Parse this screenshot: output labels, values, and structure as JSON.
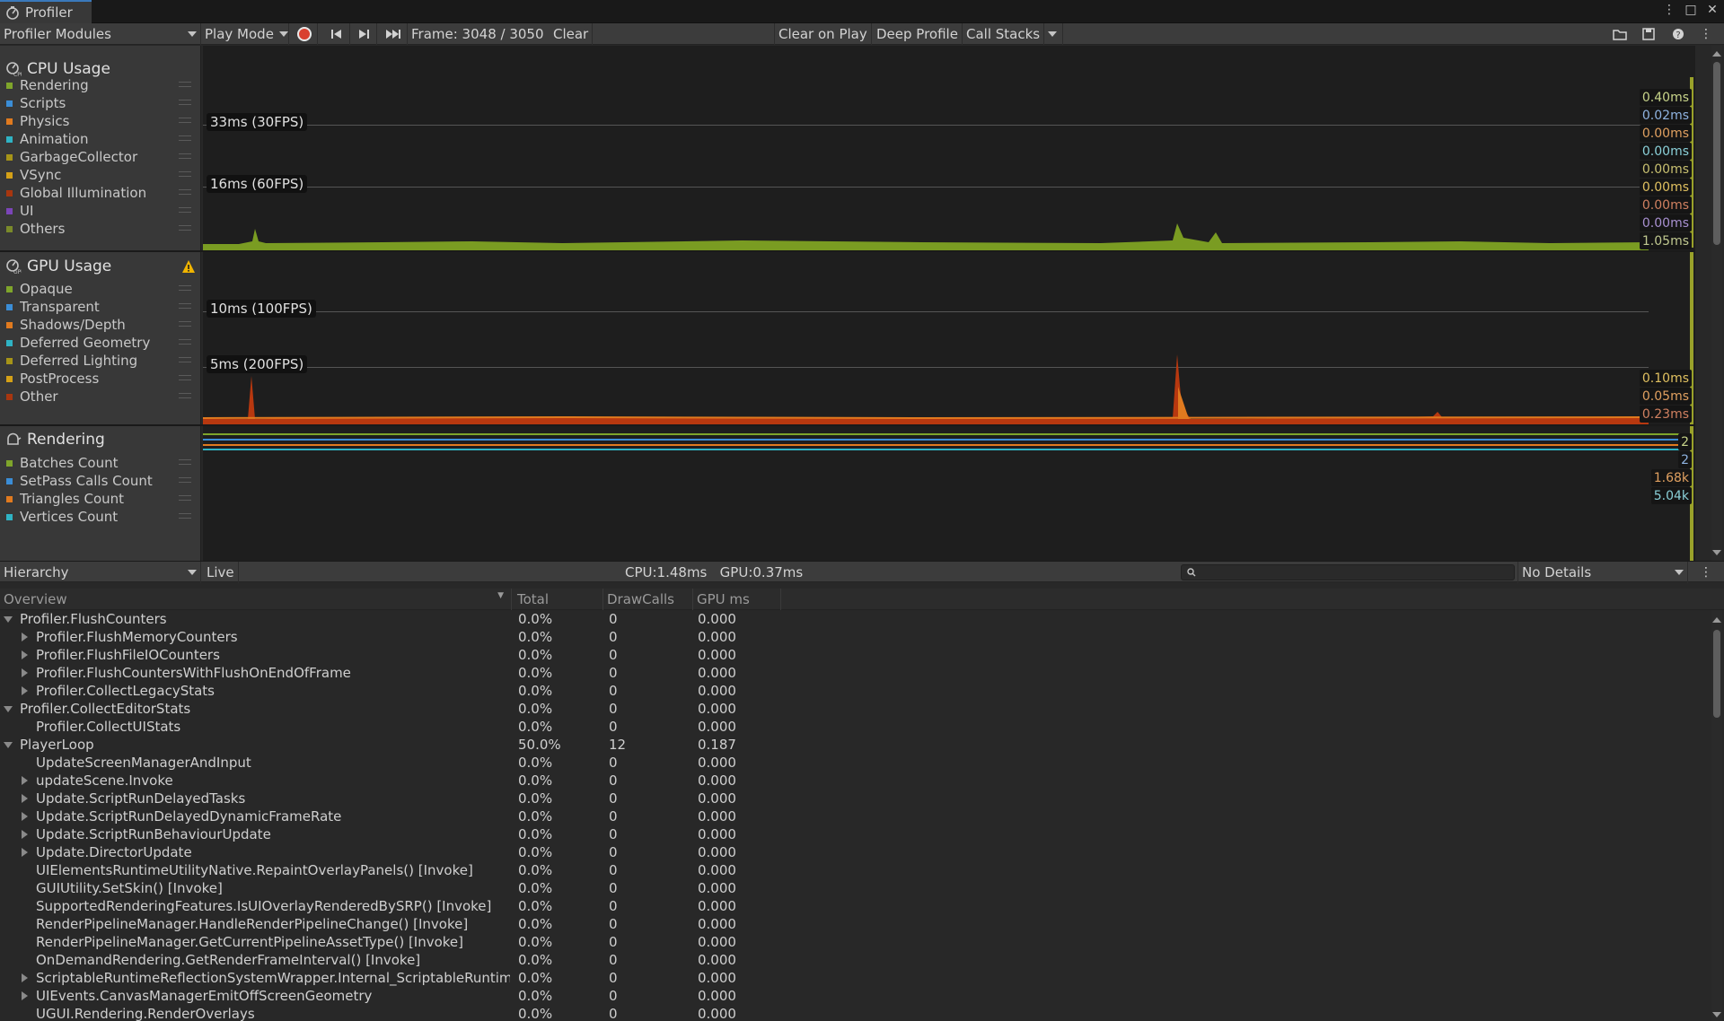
{
  "window": {
    "tab_title": "Profiler",
    "controls": [
      "⋮",
      "□",
      "✕"
    ]
  },
  "toolbar": {
    "modules_label": "Profiler Modules",
    "mode_label": "Play Mode",
    "frame_label": "Frame: 3048 / 3050",
    "clear_label": "Clear",
    "clear_on_play_label": "Clear on Play",
    "deep_profile_label": "Deep Profile",
    "call_stacks_label": "Call Stacks"
  },
  "cpu_module": {
    "title": "CPU Usage",
    "items": [
      {
        "label": "Rendering",
        "color": "#7fa52b"
      },
      {
        "label": "Scripts",
        "color": "#3b8dd6"
      },
      {
        "label": "Physics",
        "color": "#e07a1f"
      },
      {
        "label": "Animation",
        "color": "#2fb3c4"
      },
      {
        "label": "GarbageCollector",
        "color": "#a69418"
      },
      {
        "label": "VSync",
        "color": "#d4a017"
      },
      {
        "label": "Global Illumination",
        "color": "#a8360f"
      },
      {
        "label": "UI",
        "color": "#7b45b8"
      },
      {
        "label": "Others",
        "color": "#7a8a2a"
      }
    ],
    "fps_lines": [
      "33ms (30FPS)",
      "16ms (60FPS)"
    ],
    "values": [
      {
        "text": "0.40ms",
        "color": "#c8d48a"
      },
      {
        "text": "0.02ms",
        "color": "#8fb3e0"
      },
      {
        "text": "0.00ms",
        "color": "#e0a060"
      },
      {
        "text": "0.00ms",
        "color": "#8ad0d8"
      },
      {
        "text": "0.00ms",
        "color": "#c8c070"
      },
      {
        "text": "0.00ms",
        "color": "#e0c060"
      },
      {
        "text": "0.00ms",
        "color": "#d08060"
      },
      {
        "text": "0.00ms",
        "color": "#a890d0"
      },
      {
        "text": "1.05ms",
        "color": "#c0c890"
      }
    ]
  },
  "gpu_module": {
    "title": "GPU Usage",
    "items": [
      {
        "label": "Opaque",
        "color": "#7fa52b"
      },
      {
        "label": "Transparent",
        "color": "#3b8dd6"
      },
      {
        "label": "Shadows/Depth",
        "color": "#e07a1f"
      },
      {
        "label": "Deferred Geometry",
        "color": "#2fb3c4"
      },
      {
        "label": "Deferred Lighting",
        "color": "#a69418"
      },
      {
        "label": "PostProcess",
        "color": "#d4a017"
      },
      {
        "label": "Other",
        "color": "#a8360f"
      }
    ],
    "fps_lines": [
      "10ms (100FPS)",
      "5ms (200FPS)"
    ],
    "values": [
      {
        "text": "0.10ms",
        "color": "#e0c060"
      },
      {
        "text": "0.05ms",
        "color": "#e0a060"
      },
      {
        "text": "0.23ms",
        "color": "#d08060"
      }
    ]
  },
  "rendering_module": {
    "title": "Rendering",
    "items": [
      {
        "label": "Batches Count",
        "color": "#7fa52b"
      },
      {
        "label": "SetPass Calls Count",
        "color": "#3b8dd6"
      },
      {
        "label": "Triangles Count",
        "color": "#e07a1f"
      },
      {
        "label": "Vertices Count",
        "color": "#2fb3c4"
      }
    ],
    "values": [
      {
        "text": "2",
        "color": "#c8d48a"
      },
      {
        "text": "2",
        "color": "#8fb3e0"
      },
      {
        "text": "1.68k",
        "color": "#e0a060"
      },
      {
        "text": "5.04k",
        "color": "#8ad0d8"
      }
    ]
  },
  "details": {
    "view_label": "Hierarchy",
    "live_label": "Live",
    "stats_label": "CPU:1.48ms   GPU:0.37ms",
    "search_placeholder": "",
    "details_mode_label": "No Details",
    "columns": [
      "Overview",
      "Total",
      "DrawCalls",
      "GPU ms"
    ],
    "rows": [
      {
        "name": "Profiler.FlushCounters",
        "depth": 0,
        "arrow": "down",
        "total": "0.0%",
        "draw": "0",
        "gpu": "0.000"
      },
      {
        "name": "Profiler.FlushMemoryCounters",
        "depth": 1,
        "arrow": "right",
        "total": "0.0%",
        "draw": "0",
        "gpu": "0.000"
      },
      {
        "name": "Profiler.FlushFileIOCounters",
        "depth": 1,
        "arrow": "right",
        "total": "0.0%",
        "draw": "0",
        "gpu": "0.000"
      },
      {
        "name": "Profiler.FlushCountersWithFlushOnEndOfFrame",
        "depth": 1,
        "arrow": "right",
        "total": "0.0%",
        "draw": "0",
        "gpu": "0.000"
      },
      {
        "name": "Profiler.CollectLegacyStats",
        "depth": 1,
        "arrow": "right",
        "total": "0.0%",
        "draw": "0",
        "gpu": "0.000"
      },
      {
        "name": "Profiler.CollectEditorStats",
        "depth": 0,
        "arrow": "down",
        "total": "0.0%",
        "draw": "0",
        "gpu": "0.000"
      },
      {
        "name": "Profiler.CollectUIStats",
        "depth": 1,
        "arrow": "",
        "total": "0.0%",
        "draw": "0",
        "gpu": "0.000"
      },
      {
        "name": "PlayerLoop",
        "depth": 0,
        "arrow": "down",
        "total": "50.0%",
        "draw": "12",
        "gpu": "0.187"
      },
      {
        "name": "UpdateScreenManagerAndInput",
        "depth": 1,
        "arrow": "",
        "total": "0.0%",
        "draw": "0",
        "gpu": "0.000"
      },
      {
        "name": "updateScene.Invoke",
        "depth": 1,
        "arrow": "right",
        "total": "0.0%",
        "draw": "0",
        "gpu": "0.000"
      },
      {
        "name": "Update.ScriptRunDelayedTasks",
        "depth": 1,
        "arrow": "right",
        "total": "0.0%",
        "draw": "0",
        "gpu": "0.000"
      },
      {
        "name": "Update.ScriptRunDelayedDynamicFrameRate",
        "depth": 1,
        "arrow": "right",
        "total": "0.0%",
        "draw": "0",
        "gpu": "0.000"
      },
      {
        "name": "Update.ScriptRunBehaviourUpdate",
        "depth": 1,
        "arrow": "right",
        "total": "0.0%",
        "draw": "0",
        "gpu": "0.000"
      },
      {
        "name": "Update.DirectorUpdate",
        "depth": 1,
        "arrow": "right",
        "total": "0.0%",
        "draw": "0",
        "gpu": "0.000"
      },
      {
        "name": "UIElementsRuntimeUtilityNative.RepaintOverlayPanels() [Invoke]",
        "depth": 1,
        "arrow": "",
        "total": "0.0%",
        "draw": "0",
        "gpu": "0.000"
      },
      {
        "name": "GUIUtility.SetSkin() [Invoke]",
        "depth": 1,
        "arrow": "",
        "total": "0.0%",
        "draw": "0",
        "gpu": "0.000"
      },
      {
        "name": "SupportedRenderingFeatures.IsUIOverlayRenderedBySRP() [Invoke]",
        "depth": 1,
        "arrow": "",
        "total": "0.0%",
        "draw": "0",
        "gpu": "0.000"
      },
      {
        "name": "RenderPipelineManager.HandleRenderPipelineChange() [Invoke]",
        "depth": 1,
        "arrow": "",
        "total": "0.0%",
        "draw": "0",
        "gpu": "0.000"
      },
      {
        "name": "RenderPipelineManager.GetCurrentPipelineAssetType() [Invoke]",
        "depth": 1,
        "arrow": "",
        "total": "0.0%",
        "draw": "0",
        "gpu": "0.000"
      },
      {
        "name": "OnDemandRendering.GetRenderFrameInterval() [Invoke]",
        "depth": 1,
        "arrow": "",
        "total": "0.0%",
        "draw": "0",
        "gpu": "0.000"
      },
      {
        "name": "ScriptableRuntimeReflectionSystemWrapper.Internal_ScriptableRuntimeRe",
        "depth": 1,
        "arrow": "right",
        "total": "0.0%",
        "draw": "0",
        "gpu": "0.000"
      },
      {
        "name": "UIEvents.CanvasManagerEmitOffScreenGeometry",
        "depth": 1,
        "arrow": "right",
        "total": "0.0%",
        "draw": "0",
        "gpu": "0.000"
      },
      {
        "name": "UGUI.Rendering.RenderOverlays",
        "depth": 1,
        "arrow": "",
        "total": "0.0%",
        "draw": "0",
        "gpu": "0.000"
      }
    ]
  }
}
